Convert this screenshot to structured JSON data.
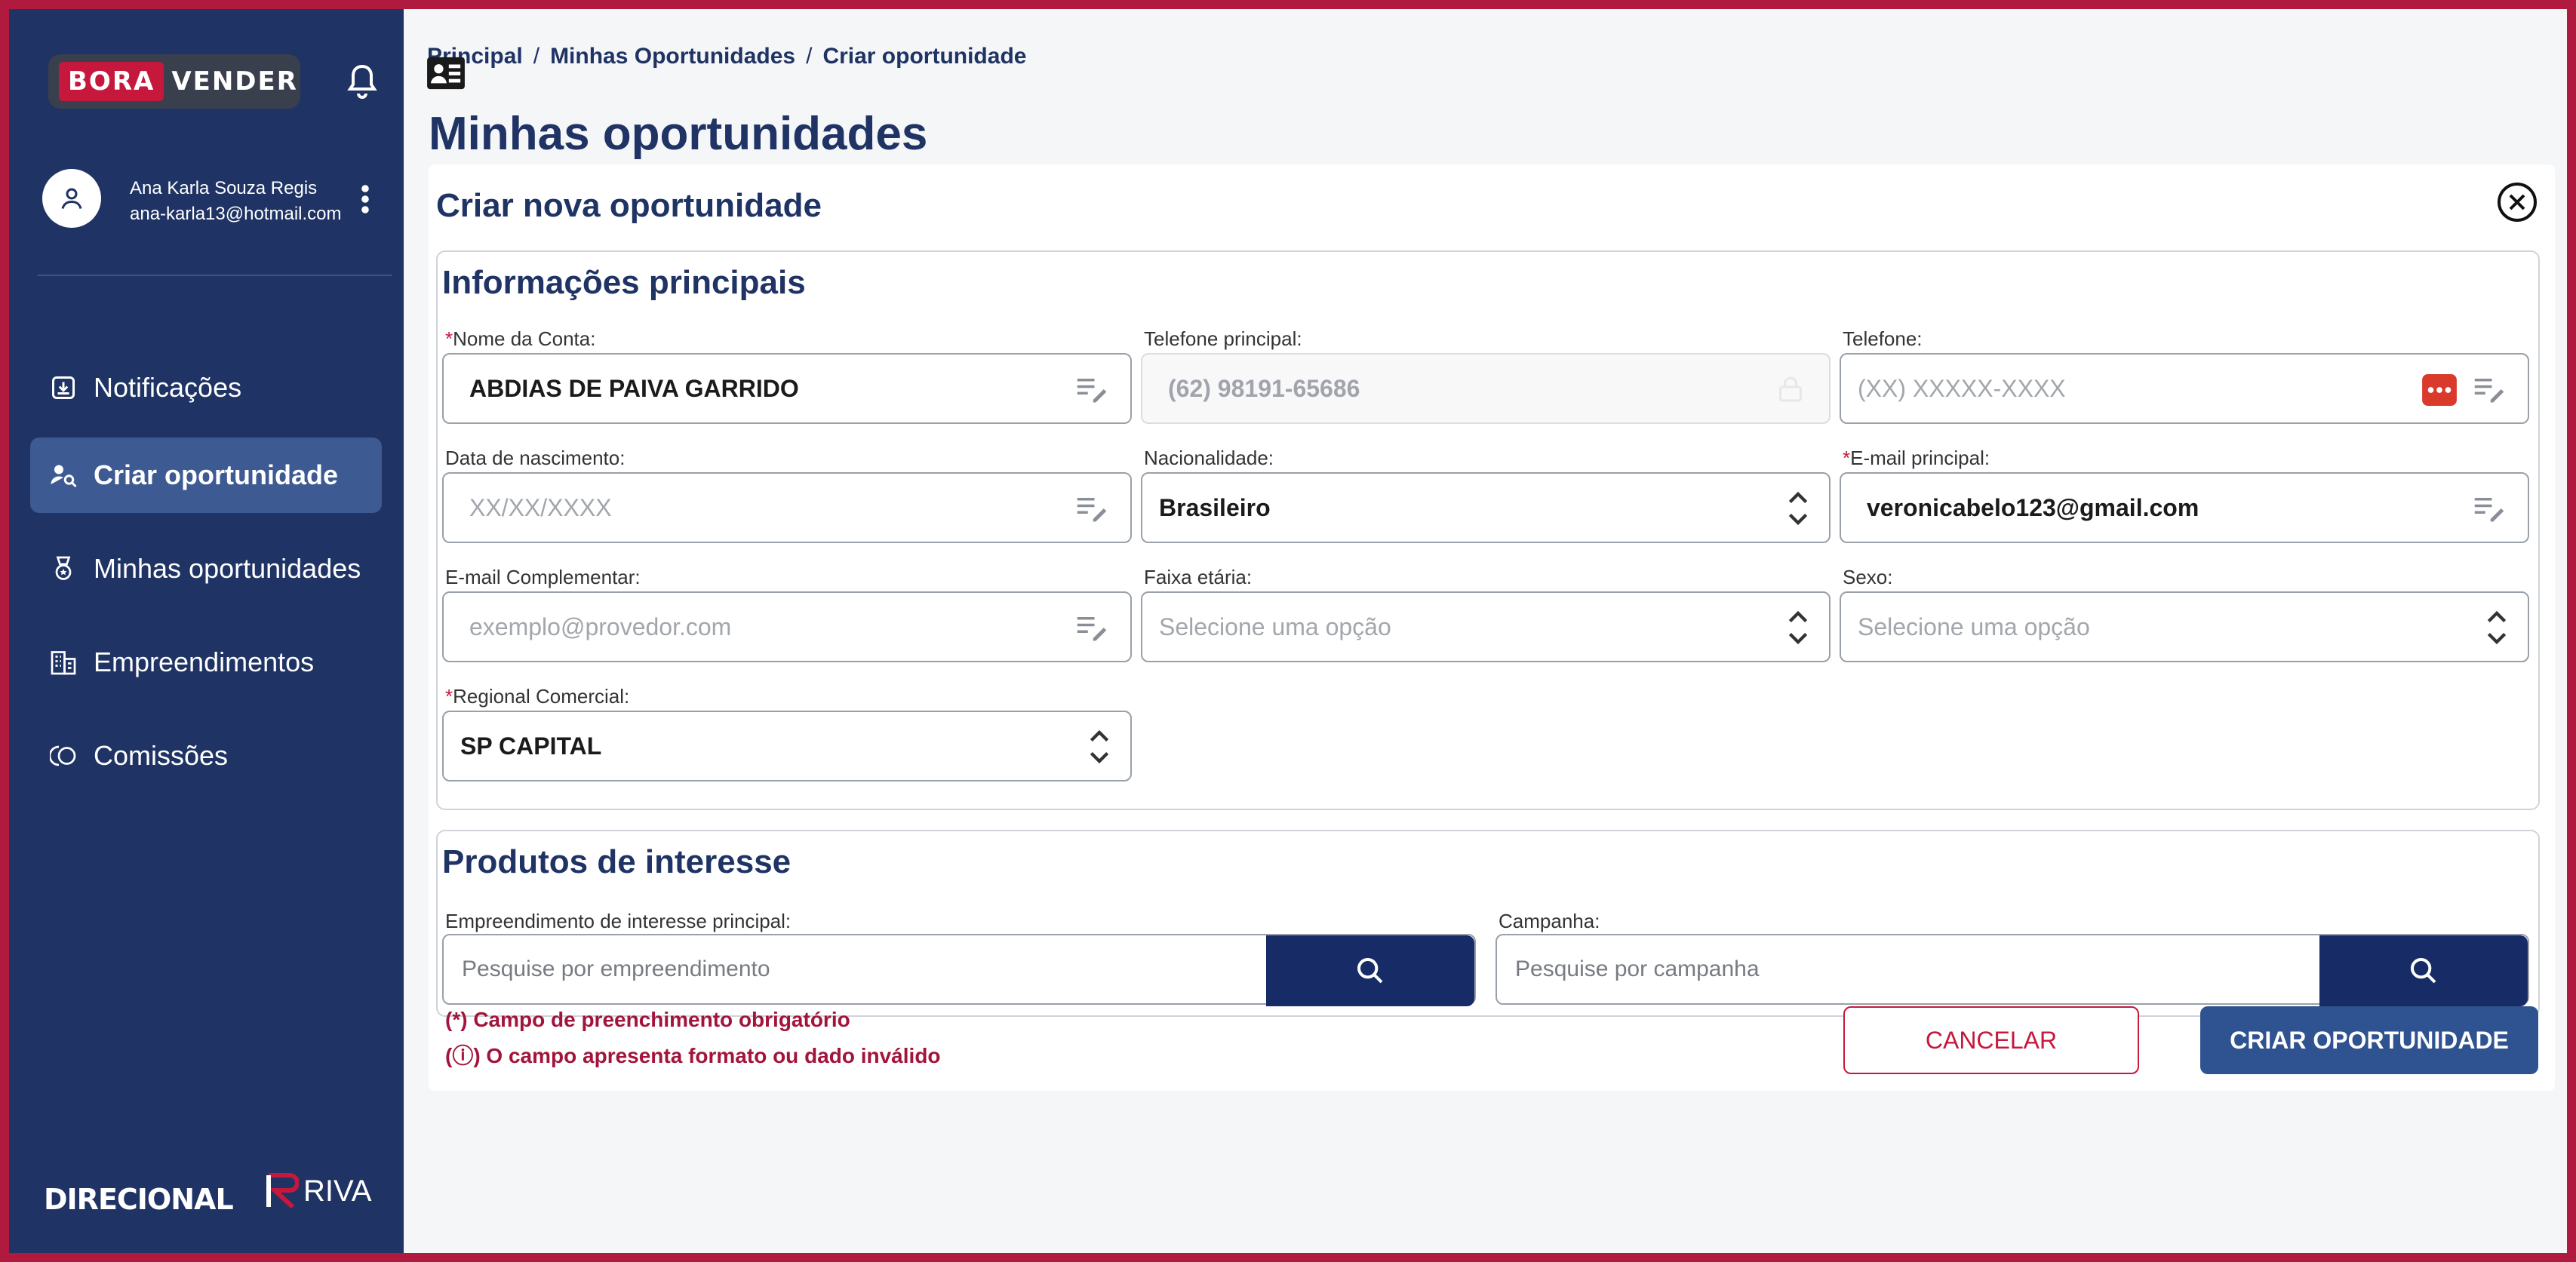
{
  "sidebar": {
    "logo": {
      "part1": "BORA",
      "part2": "VENDER"
    },
    "user": {
      "name": "Ana Karla Souza Regis",
      "email": "ana-karla13@hotmail.com"
    },
    "items": [
      {
        "label": "Notificações",
        "icon": "inbox-icon"
      },
      {
        "label": "Criar oportunidade",
        "icon": "user-search-icon",
        "active": true
      },
      {
        "label": "Minhas oportunidades",
        "icon": "badge-icon"
      },
      {
        "label": "Empreendimentos",
        "icon": "building-icon"
      },
      {
        "label": "Comissões",
        "icon": "coins-icon"
      }
    ],
    "brands": {
      "left": "DIRECIONAL",
      "right": "RIVA"
    }
  },
  "breadcrumb": [
    "Principal",
    "Minhas Oportunidades",
    "Criar oportunidade"
  ],
  "page_title": "Minhas oportunidades",
  "form": {
    "title": "Criar nova oportunidade",
    "main_section": {
      "title": "Informações principais",
      "fields": {
        "nome_conta": {
          "label": "Nome da Conta:",
          "value": "ABDIAS DE PAIVA GARRIDO"
        },
        "telefone_principal": {
          "label": "Telefone principal:",
          "value": "(62) 98191-65686"
        },
        "telefone": {
          "label": "Telefone:",
          "placeholder": "(XX) XXXXX-XXXX"
        },
        "nascimento": {
          "label": "Data de nascimento:",
          "placeholder": "XX/XX/XXXX"
        },
        "nacionalidade": {
          "label": "Nacionalidade:",
          "value": "Brasileiro"
        },
        "email_principal": {
          "label": "E-mail principal:",
          "value": "veronicabelo123@gmail.com"
        },
        "email_complementar": {
          "label": "E-mail Complementar:",
          "placeholder": "exemplo@provedor.com"
        },
        "faixa_etaria": {
          "label": "Faixa etária:",
          "placeholder": "Selecione uma opção"
        },
        "sexo": {
          "label": "Sexo:",
          "placeholder": "Selecione uma opção"
        },
        "regional": {
          "label": "Regional Comercial:",
          "value": "SP CAPITAL"
        }
      }
    },
    "products_section": {
      "title": "Produtos de interesse",
      "empreendimento": {
        "label": "Empreendimento de interesse principal:",
        "placeholder": "Pesquise por empreendimento"
      },
      "campanha": {
        "label": "Campanha:",
        "placeholder": "Pesquise por campanha"
      }
    },
    "notes": {
      "required": "(*) Campo de preenchimento obrigatório",
      "invalid": "(ⓘ) O campo apresenta formato ou dado inválido"
    },
    "buttons": {
      "cancel": "CANCELAR",
      "create": "CRIAR OPORTUNIDADE"
    }
  },
  "colors": {
    "primary": "#1f3364",
    "accent": "#c6183d",
    "button": "#2f5290"
  }
}
